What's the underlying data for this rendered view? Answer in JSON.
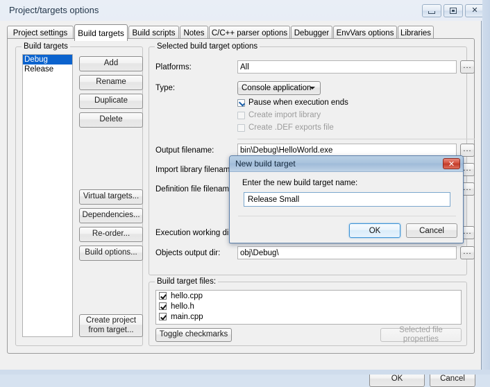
{
  "window": {
    "title": "Project/targets options",
    "controls": {
      "minimize": "minimize-icon",
      "maximize": "maximize-icon",
      "close": "✕"
    }
  },
  "tabs": [
    {
      "label": "Project settings",
      "active": false
    },
    {
      "label": "Build targets",
      "active": true
    },
    {
      "label": "Build scripts",
      "active": false
    },
    {
      "label": "Notes",
      "active": false
    },
    {
      "label": "C/C++ parser options",
      "active": false
    },
    {
      "label": "Debugger",
      "active": false
    },
    {
      "label": "EnvVars options",
      "active": false
    },
    {
      "label": "Libraries",
      "active": false
    }
  ],
  "build_targets": {
    "group_label": "Build targets",
    "items": [
      {
        "label": "Debug",
        "selected": true
      },
      {
        "label": "Release",
        "selected": false
      }
    ],
    "buttons": {
      "add": "Add",
      "rename": "Rename",
      "duplicate": "Duplicate",
      "delete": "Delete",
      "virtual_targets": "Virtual targets...",
      "dependencies": "Dependencies...",
      "reorder": "Re-order...",
      "build_options": "Build options...",
      "create_project": "Create project\nfrom target..."
    }
  },
  "selected_target": {
    "group_label": "Selected build target options",
    "platforms_label": "Platforms:",
    "platforms_value": "All",
    "type_label": "Type:",
    "type_value": "Console application",
    "checkboxes": [
      {
        "label": "Pause when execution ends",
        "checked": true,
        "enabled": true
      },
      {
        "label": "Create import library",
        "checked": false,
        "enabled": false
      },
      {
        "label": "Create .DEF exports file",
        "checked": false,
        "enabled": false
      }
    ],
    "fields": [
      {
        "label": "Output filename:",
        "value": "bin\\Debug\\HelloWorld.exe"
      },
      {
        "label": "Import library filename:",
        "value": ""
      },
      {
        "label": "Definition file filename:",
        "value": ""
      },
      {
        "label": "Execution working dir:",
        "value": ""
      },
      {
        "label": "Objects output dir:",
        "value": "obj\\Debug\\"
      }
    ],
    "browse_label": "..."
  },
  "build_target_files": {
    "group_label": "Build target files:",
    "files": [
      {
        "name": "hello.cpp",
        "checked": true
      },
      {
        "name": "hello.h",
        "checked": true
      },
      {
        "name": "main.cpp",
        "checked": true
      }
    ],
    "toggle_button": "Toggle checkmarks",
    "properties_button": "Selected file properties"
  },
  "footer": {
    "ok": "OK",
    "cancel": "Cancel"
  },
  "dialog": {
    "title": "New build target",
    "close_glyph": "✕",
    "prompt": "Enter the new build target name:",
    "input_value": "Release Small",
    "input_placeholder": "",
    "ok": "OK",
    "cancel": "Cancel"
  },
  "colors": {
    "selection_blue": "#0b63ce",
    "dialog_titlebar": "#a9c3dd",
    "close_red": "#c03b29",
    "window_bg": "#f0f0f0"
  }
}
